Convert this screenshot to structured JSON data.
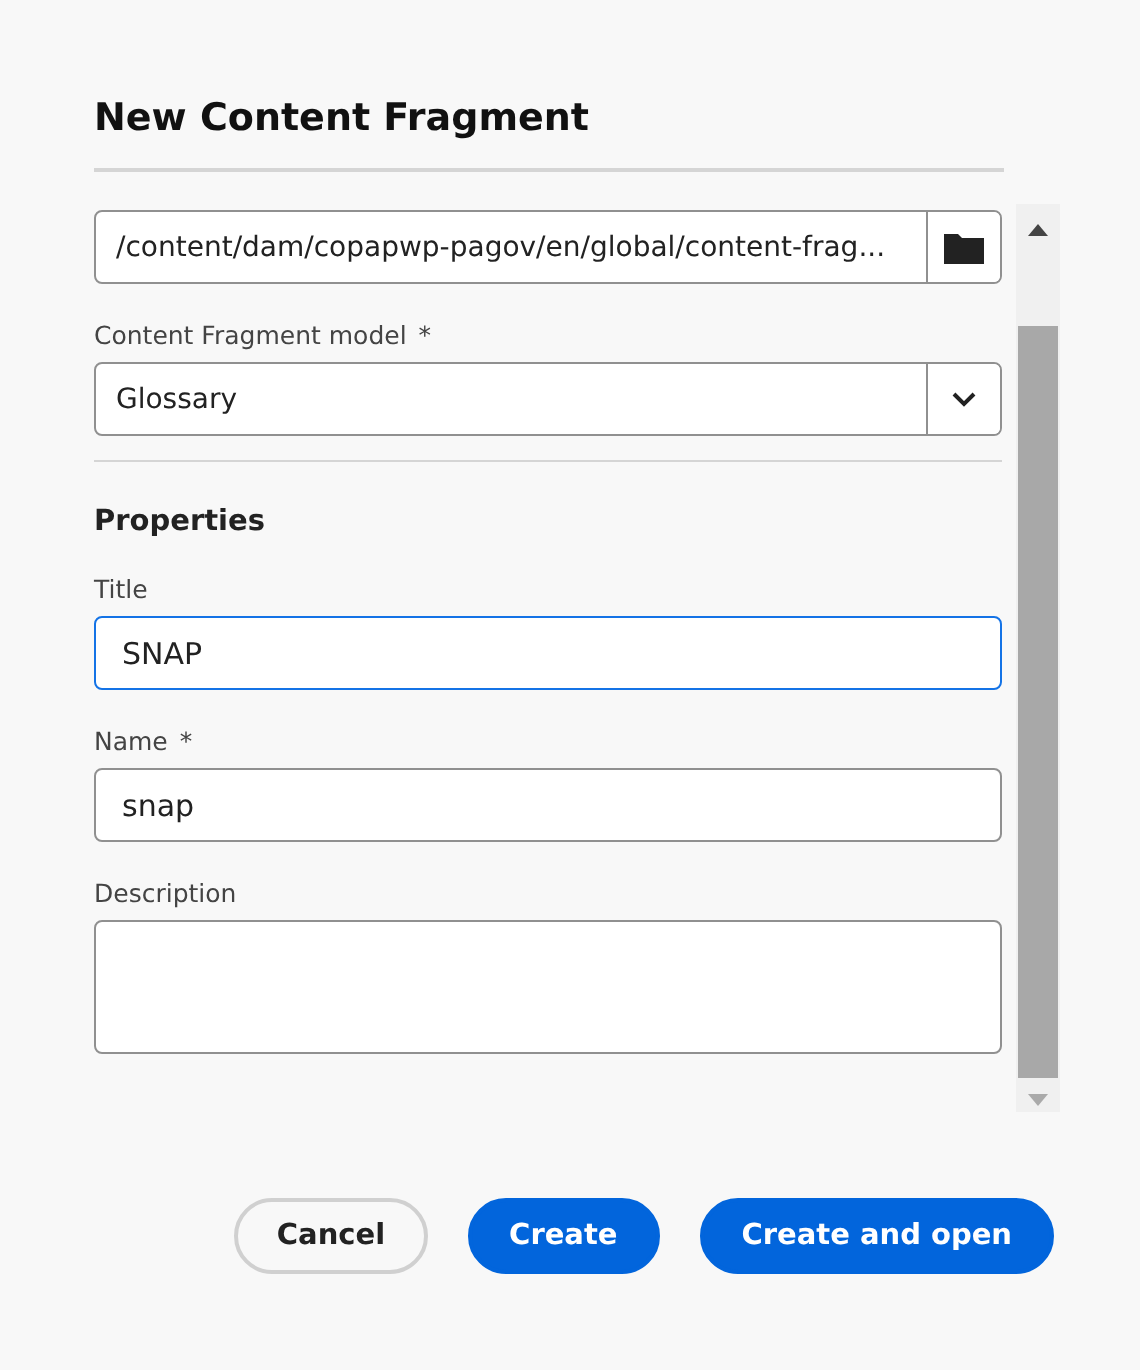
{
  "dialog": {
    "title": "New Content Fragment"
  },
  "location": {
    "kind": "path",
    "value": "/content/dam/copapwp-pagov/en/global/content-frag..."
  },
  "model": {
    "kind": "select",
    "label": "Content Fragment model",
    "required_mark": "*",
    "value": "Glossary"
  },
  "section": {
    "title": "Properties"
  },
  "fields": [
    {
      "kind": "text",
      "label": "Title",
      "focused": true,
      "value": "SNAP"
    },
    {
      "kind": "text",
      "label": "Name",
      "required_mark": "*",
      "focused": false,
      "value": "snap"
    },
    {
      "kind": "textarea",
      "label": "Description",
      "focused": false
    }
  ],
  "buttons": [
    {
      "kind": "secondary",
      "label": "Cancel"
    },
    {
      "kind": "primary",
      "label": "Create"
    },
    {
      "kind": "primary",
      "label": "Create and open"
    }
  ]
}
